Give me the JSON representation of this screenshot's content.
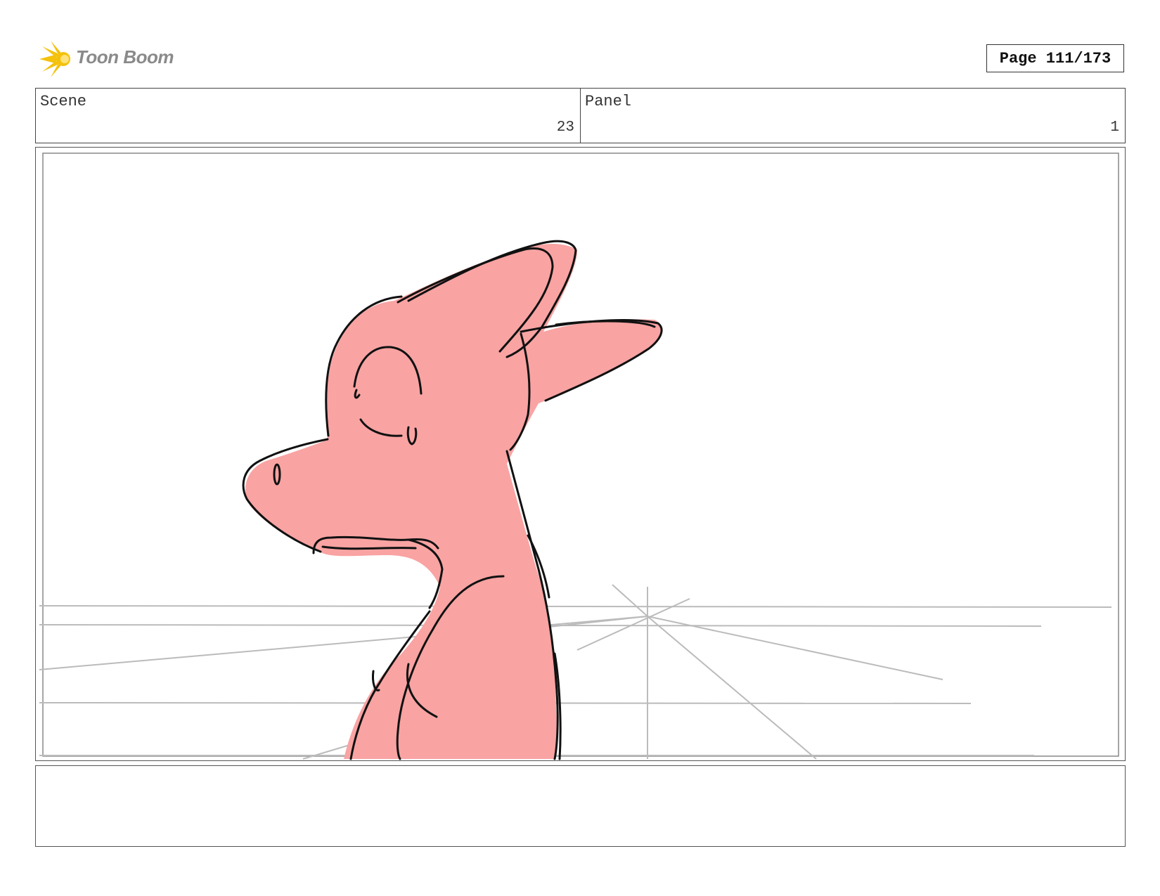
{
  "header": {
    "logo_text": "Toon Boom",
    "logo_icon": "starburst-logo-icon",
    "page_label": "Page 111/173"
  },
  "info": {
    "scene_label": "Scene",
    "scene_value": "23",
    "panel_label": "Panel",
    "panel_value": "1"
  },
  "panel": {
    "fill_color": "#f9a3a3",
    "line_color": "#111111",
    "guide_color": "#b8b8b8"
  },
  "notes": {
    "text": ""
  }
}
